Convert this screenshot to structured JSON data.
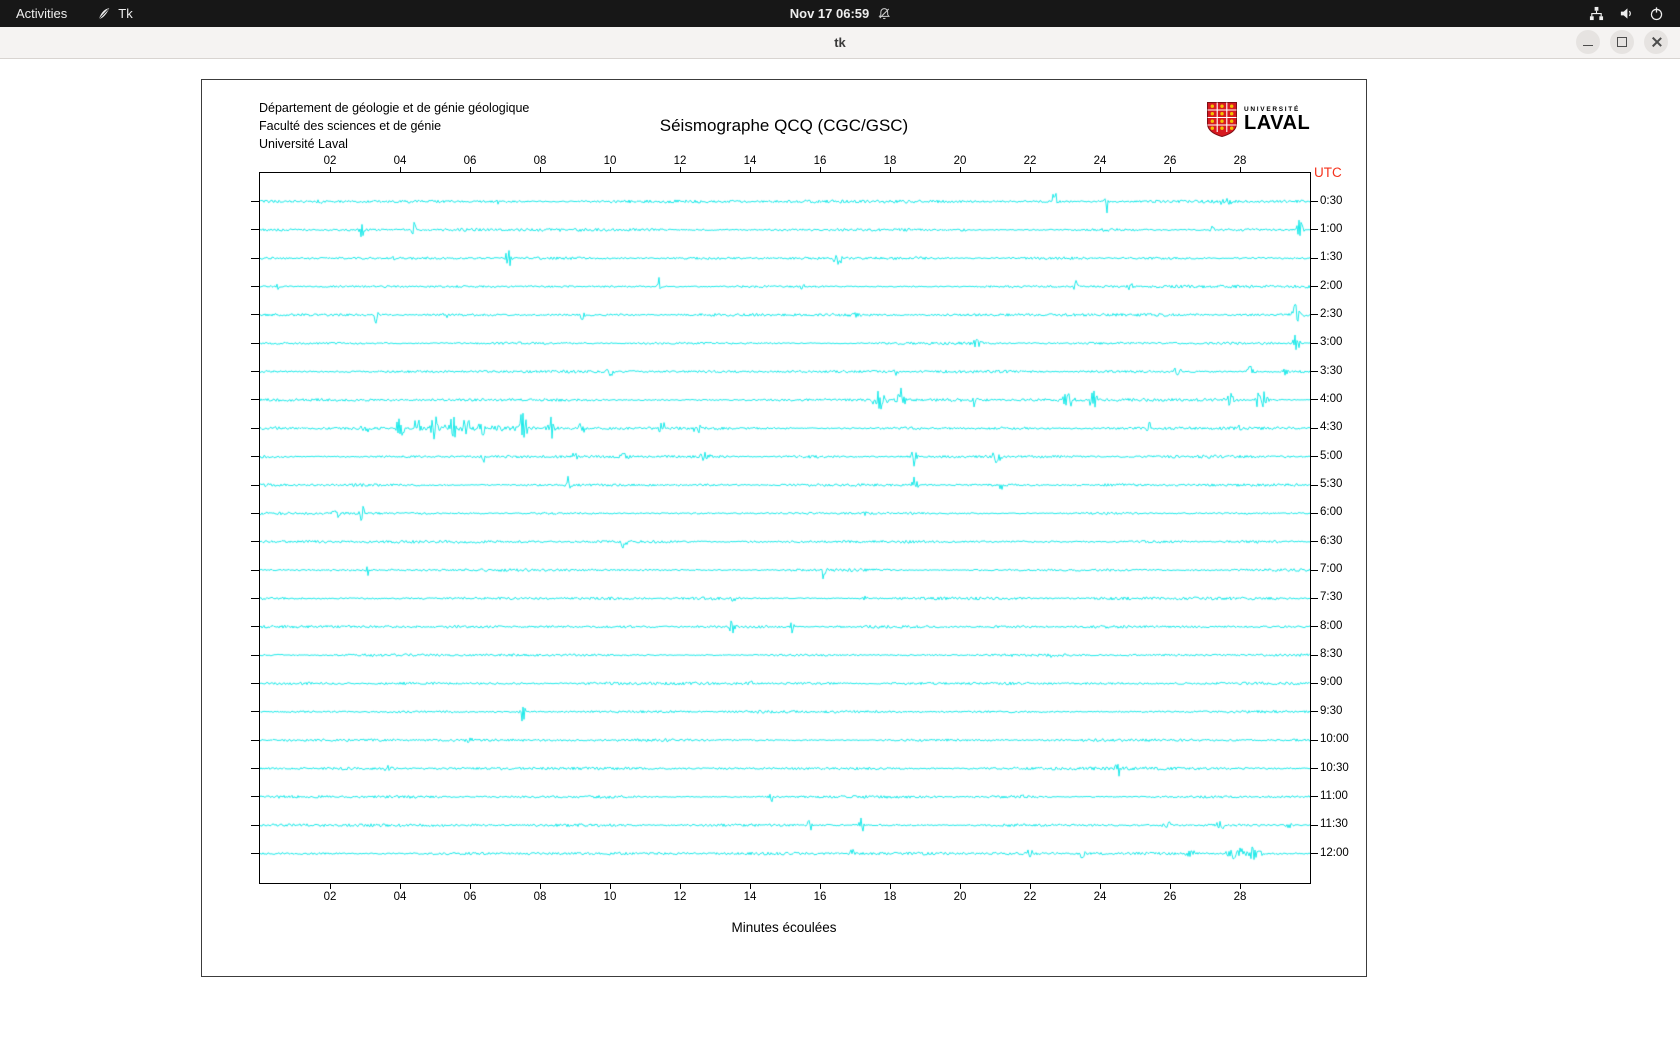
{
  "top_bar": {
    "activities": "Activities",
    "app_name": "Tk",
    "clock": "Nov 17  06:59"
  },
  "window": {
    "title": "tk"
  },
  "figure": {
    "header_lines": [
      "Département de géologie et de génie géologique",
      "Faculté des sciences et de génie",
      "Université Laval"
    ],
    "title": "Séismographe QCQ (CGC/GSC)",
    "utc": "UTC",
    "xlabel": "Minutes écoulées",
    "logo": {
      "line1": "UNIVERSITÉ",
      "line2": "LAVAL"
    },
    "colors": {
      "trace": "#00e6e6",
      "utc": "#f5321c",
      "shield": "#d71920",
      "shield_dot": "#f2c200"
    },
    "x_ticks": [
      "02",
      "04",
      "06",
      "08",
      "10",
      "12",
      "14",
      "16",
      "18",
      "20",
      "22",
      "24",
      "26",
      "28"
    ],
    "y_labels": [
      "0:30",
      "1:00",
      "1:30",
      "2:00",
      "2:30",
      "3:00",
      "3:30",
      "4:00",
      "4:30",
      "5:00",
      "5:30",
      "6:00",
      "6:30",
      "7:00",
      "7:30",
      "8:00",
      "8:30",
      "9:00",
      "9:30",
      "10:00",
      "10:30",
      "11:00",
      "11:30",
      "12:00"
    ],
    "plot": {
      "x_min": 0,
      "x_max": 30,
      "rows": 24
    },
    "events": [
      [
        0,
        1.7,
        3,
        1.5
      ],
      [
        0,
        6.8,
        3,
        1.5
      ],
      [
        0,
        22.7,
        13,
        1.6
      ],
      [
        0,
        24.2,
        15,
        1.6
      ],
      [
        0,
        27.6,
        4,
        5
      ],
      [
        1,
        2.9,
        11,
        1.6
      ],
      [
        1,
        4.4,
        9,
        1.6
      ],
      [
        1,
        20.1,
        3,
        2
      ],
      [
        1,
        27.2,
        4,
        1.6
      ],
      [
        1,
        29.7,
        11,
        2.5
      ],
      [
        2,
        3.8,
        3,
        1.6
      ],
      [
        2,
        7.1,
        10,
        2.2
      ],
      [
        2,
        16.5,
        8,
        3
      ],
      [
        3,
        0.5,
        3,
        1.5
      ],
      [
        3,
        11.4,
        10,
        1.6
      ],
      [
        3,
        15.5,
        3,
        1.5
      ],
      [
        3,
        23.3,
        6,
        1.6
      ],
      [
        3,
        24.9,
        3,
        4
      ],
      [
        4,
        3.3,
        9,
        1.6
      ],
      [
        4,
        5.3,
        7,
        1.6
      ],
      [
        4,
        9.2,
        9,
        1.6
      ],
      [
        4,
        17.0,
        3,
        1.6
      ],
      [
        4,
        29.6,
        16,
        2.5
      ],
      [
        5,
        20.5,
        5,
        4
      ],
      [
        5,
        29.6,
        9,
        2.5
      ],
      [
        6,
        10.0,
        4,
        4
      ],
      [
        6,
        18.2,
        7,
        1.6
      ],
      [
        6,
        26.2,
        4,
        4
      ],
      [
        6,
        28.3,
        8,
        2.5
      ],
      [
        6,
        29.3,
        5,
        1.6
      ],
      [
        7,
        6.4,
        4,
        1.5
      ],
      [
        7,
        17.7,
        12,
        4
      ],
      [
        7,
        18.3,
        14,
        3
      ],
      [
        7,
        20.4,
        7,
        1.6
      ],
      [
        7,
        23.1,
        9,
        4
      ],
      [
        7,
        23.8,
        11,
        3
      ],
      [
        7,
        27.7,
        7,
        3
      ],
      [
        7,
        28.6,
        11,
        4
      ],
      [
        8,
        0.5,
        5,
        1.6
      ],
      [
        8,
        3.0,
        7,
        2.5
      ],
      [
        8,
        4.0,
        13,
        2.5
      ],
      [
        8,
        4.5,
        15,
        2.5
      ],
      [
        8,
        5.0,
        17,
        2.5
      ],
      [
        8,
        5.5,
        15,
        2.5
      ],
      [
        8,
        5.9,
        13,
        2.5
      ],
      [
        8,
        6.4,
        11,
        2.5
      ],
      [
        8,
        7.5,
        18,
        3
      ],
      [
        8,
        8.3,
        13,
        2.5
      ],
      [
        8,
        9.2,
        9,
        2.5
      ],
      [
        8,
        11.5,
        8,
        2.5
      ],
      [
        8,
        12.5,
        7,
        2.5
      ],
      [
        8,
        6.0,
        2.5,
        45
      ],
      [
        8,
        25.4,
        6,
        1.6
      ],
      [
        8,
        28.0,
        4,
        1.6
      ],
      [
        9,
        6.4,
        5,
        1.6
      ],
      [
        9,
        9.0,
        7,
        1.6
      ],
      [
        9,
        10.4,
        5,
        3
      ],
      [
        9,
        12.7,
        7,
        2.5
      ],
      [
        9,
        18.7,
        13,
        1.8
      ],
      [
        9,
        21.0,
        7,
        4
      ],
      [
        10,
        8.8,
        9,
        1.6
      ],
      [
        10,
        18.7,
        13,
        1.8
      ],
      [
        10,
        21.2,
        7,
        1.8
      ],
      [
        11,
        2.2,
        7,
        2.5
      ],
      [
        11,
        2.9,
        9,
        1.8
      ],
      [
        11,
        17.3,
        3,
        1.6
      ],
      [
        12,
        10.4,
        11,
        1.6
      ],
      [
        13,
        3.1,
        7,
        1.6
      ],
      [
        13,
        16.1,
        9,
        1.6
      ],
      [
        14,
        13.5,
        6,
        1.6
      ],
      [
        14,
        17.3,
        4,
        1.6
      ],
      [
        15,
        13.5,
        11,
        1.7
      ],
      [
        15,
        15.2,
        7,
        1.7
      ],
      [
        16,
        22.6,
        3,
        1.6
      ],
      [
        17,
        14.0,
        2.5,
        2.5
      ],
      [
        18,
        7.5,
        12,
        1.7
      ],
      [
        19,
        6.0,
        3,
        3
      ],
      [
        20,
        3.7,
        4,
        3
      ],
      [
        20,
        24.5,
        11,
        1.7
      ],
      [
        21,
        14.6,
        7,
        1.7
      ],
      [
        21,
        21.8,
        4,
        1.6
      ],
      [
        22,
        15.7,
        7,
        1.7
      ],
      [
        22,
        17.2,
        11,
        1.7
      ],
      [
        22,
        25.9,
        5,
        3.5
      ],
      [
        22,
        27.4,
        5,
        3.5
      ],
      [
        22,
        29.4,
        4,
        1.7
      ],
      [
        23,
        16.9,
        5,
        1.7
      ],
      [
        23,
        22.0,
        4,
        3.5
      ],
      [
        23,
        23.5,
        7,
        1.7
      ],
      [
        23,
        26.6,
        5,
        4
      ],
      [
        23,
        27.9,
        7,
        6
      ],
      [
        23,
        28.4,
        8,
        4
      ]
    ]
  }
}
